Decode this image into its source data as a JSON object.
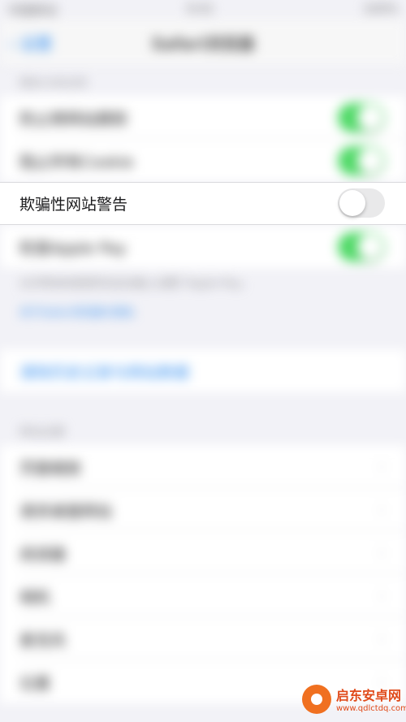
{
  "status_bar": {
    "carrier": "中国移动",
    "time": "9:41",
    "battery": "100%"
  },
  "nav": {
    "back_label": "设置",
    "title": "Safari浏览器"
  },
  "privacy_section": {
    "header": "隐私与安全性",
    "items": [
      {
        "label": "防止跨网站跟踪",
        "state": "on"
      },
      {
        "label": "阻止所有Cookie",
        "state": "on"
      }
    ]
  },
  "fraud_warning": {
    "label": "欺骗性网站警告",
    "state": "off"
  },
  "apple_pay": {
    "label": "检查Apple Pay"
  },
  "privacy_footer": {
    "text": "允许网站检查是否在此设备上设置了Apple Pay。",
    "link": "关于Safari浏览器与隐私"
  },
  "clear_history": {
    "label": "清除历史记录与网站数据"
  },
  "website_section": {
    "header": "网站设置",
    "items": [
      {
        "label": "页面缩放"
      },
      {
        "label": "请求桌面网站"
      },
      {
        "label": "阅读器"
      },
      {
        "label": "相机"
      },
      {
        "label": "麦克风"
      },
      {
        "label": "位置"
      }
    ]
  },
  "colors": {
    "switch_on": "#4cd964",
    "switch_off": "#e9e9ea",
    "link": "#2f8cf0"
  },
  "watermark": {
    "logo_text": "启东安卓网",
    "url": "www.qdlctdq.com"
  }
}
